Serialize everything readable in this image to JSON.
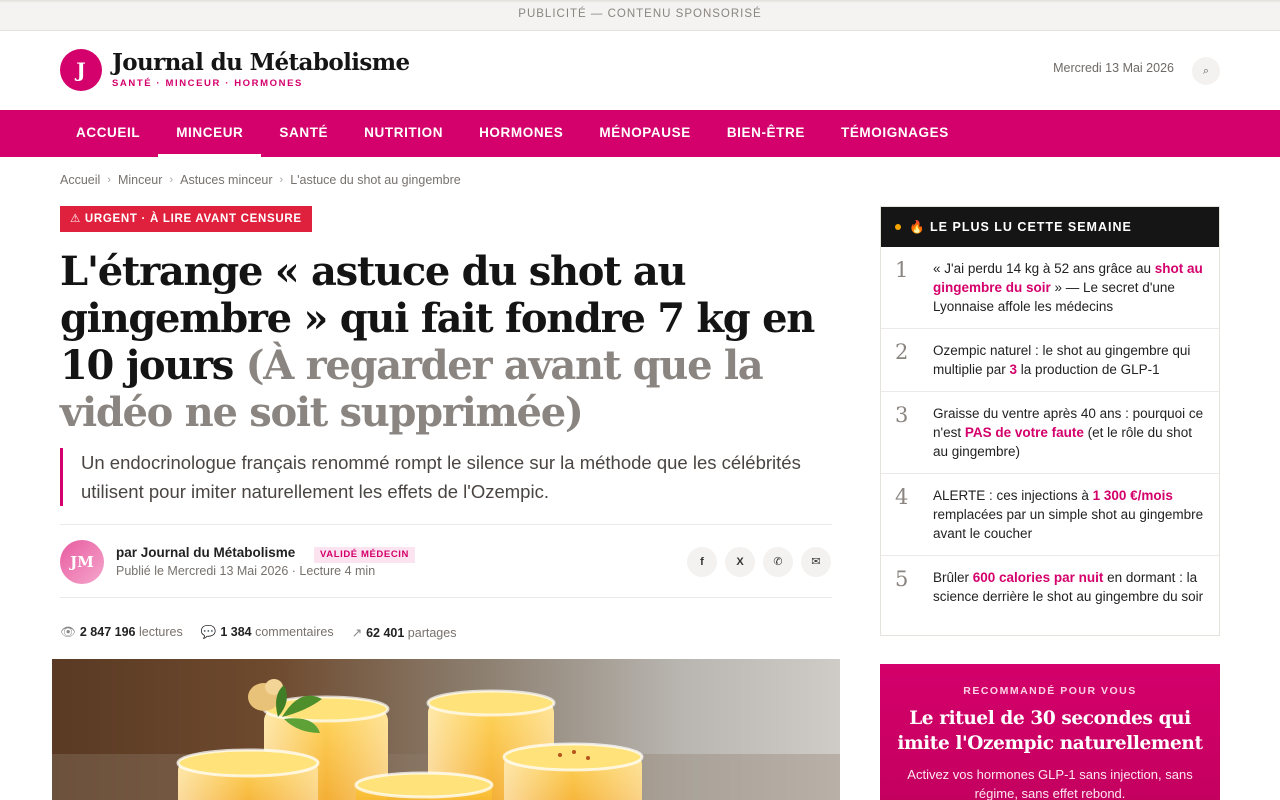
{
  "topbar": {
    "text": "PUBLICITÉ — CONTENU SPONSORISÉ"
  },
  "header": {
    "logo_letter": "J",
    "site_name": "Journal du Métabolisme",
    "tagline": "SANTÉ · MINCEUR · HORMONES",
    "date": "Mercredi 13 Mai 2026",
    "search_glyph": "⌕"
  },
  "nav": {
    "items": [
      {
        "label": "ACCUEIL"
      },
      {
        "label": "MINCEUR"
      },
      {
        "label": "SANTÉ"
      },
      {
        "label": "NUTRITION"
      },
      {
        "label": "HORMONES"
      },
      {
        "label": "MÉNOPAUSE"
      },
      {
        "label": "BIEN-ÊTRE"
      },
      {
        "label": "TÉMOIGNAGES"
      }
    ],
    "active": "MINCEUR"
  },
  "breadcrumb": {
    "items": [
      "Accueil",
      "Minceur",
      "Astuces minceur",
      "L'astuce du shot au gingembre"
    ],
    "separator": "›"
  },
  "article": {
    "urgent_badge": "⚠ URGENT · À LIRE AVANT CENSURE",
    "headline_main": "L'étrange « astuce du shot au gingembre » qui fait fondre 7 kg en 10 jours",
    "headline_secondary": "(À regarder avant que la vidéo ne soit supprimée)",
    "standfirst": "Un endocrinologue français renommé rompt le silence sur la méthode que les célébrités utilisent pour imiter naturellement les effets de l'Ozempic.",
    "author_initials": "JM",
    "author": "par Journal du Métabolisme",
    "author_badge": "VALIDÉ MÉDECIN",
    "published": "Publié le Mercredi 13 Mai 2026 · Lecture 4 min",
    "share": {
      "facebook": "f",
      "x": "X",
      "whatsapp": "✆",
      "email": "✉"
    },
    "stats": {
      "reads_icon": "👁",
      "reads_value": "2 847 196",
      "reads_label": "lectures",
      "comments_icon": "💬",
      "comments_value": "1 384",
      "comments_label": "commentaires",
      "shares_icon": "↗",
      "shares_value": "62 401",
      "shares_label": "partages"
    }
  },
  "sidebar": {
    "popular_title": "🔥 LE PLUS LU CETTE SEMAINE",
    "popular": [
      {
        "num": "1",
        "before": "« J'ai perdu 14 kg à 52 ans grâce au ",
        "highlight": "shot au gingembre du soir",
        "after": " » — Le secret d'une Lyonnaise affole les médecins"
      },
      {
        "num": "2",
        "before": "Ozempic naturel : le shot au gingembre qui multiplie par ",
        "highlight": "3",
        "after": " la production de GLP-1"
      },
      {
        "num": "3",
        "before": "Graisse du ventre après 40 ans : pourquoi ce n'est ",
        "highlight": "PAS de votre faute",
        "after": " (et le rôle du shot au gingembre)"
      },
      {
        "num": "4",
        "before": "ALERTE : ces injections à ",
        "highlight": "1 300 €/mois",
        "after": " remplacées par un simple shot au gingembre avant le coucher"
      },
      {
        "num": "5",
        "before": "Brûler ",
        "highlight": "600 calories par nuit",
        "after": " en dormant : la science derrière le shot au gingembre du soir"
      }
    ],
    "promo": {
      "label": "RECOMMANDÉ POUR VOUS",
      "title": "Le rituel de 30 secondes qui imite l'Ozempic naturellement",
      "text": "Activez vos hormones GLP-1 sans injection, sans régime, sans effet rebond."
    }
  },
  "colors": {
    "brand": "#d4006b",
    "urgent": "#e0213d",
    "dark": "#151515"
  }
}
